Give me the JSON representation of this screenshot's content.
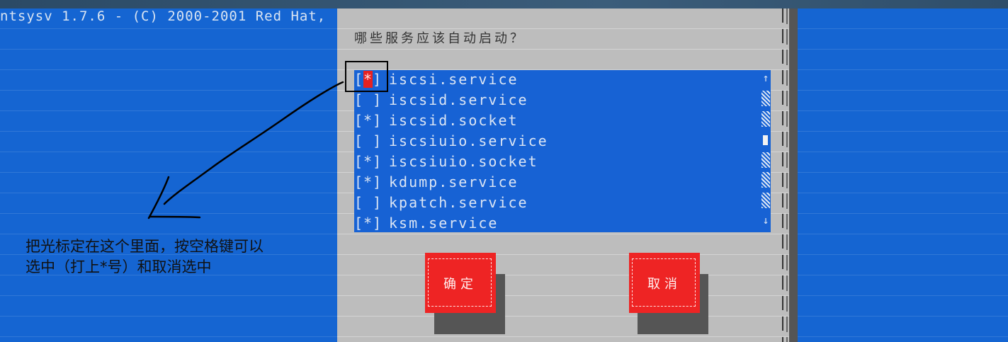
{
  "window": {
    "title_line": "ntsysv 1.7.6 - (C) 2000-2001 Red Hat,"
  },
  "dialog": {
    "prompt": "哪些服务应该自动启动？",
    "services": [
      {
        "check": "[*]",
        "name": "iscsi.service",
        "checked": true,
        "focused": true
      },
      {
        "check": "[ ]",
        "name": "iscsid.service",
        "checked": false
      },
      {
        "check": "[*]",
        "name": "iscsid.socket",
        "checked": true
      },
      {
        "check": "[ ]",
        "name": "iscsiuio.service",
        "checked": false
      },
      {
        "check": "[*]",
        "name": "iscsiuio.socket",
        "checked": true
      },
      {
        "check": "[*]",
        "name": "kdump.service",
        "checked": true
      },
      {
        "check": "[ ]",
        "name": "kpatch.service",
        "checked": false
      },
      {
        "check": "[*]",
        "name": "ksm.service",
        "checked": true
      }
    ],
    "scrollbar": {
      "up_arrow": "↑",
      "down_arrow": "↓"
    },
    "buttons": {
      "ok": "确定",
      "cancel": "取消"
    }
  },
  "annotation": {
    "line1": "把光标定在这个里面，按空格键可以",
    "line2": "选中（打上*号）和取消选中"
  },
  "colors": {
    "background": "#1565d2",
    "dialog": "#bdbdbd",
    "listbox": "#1762d4",
    "button": "#ee2424",
    "cursor": "#e52222"
  }
}
